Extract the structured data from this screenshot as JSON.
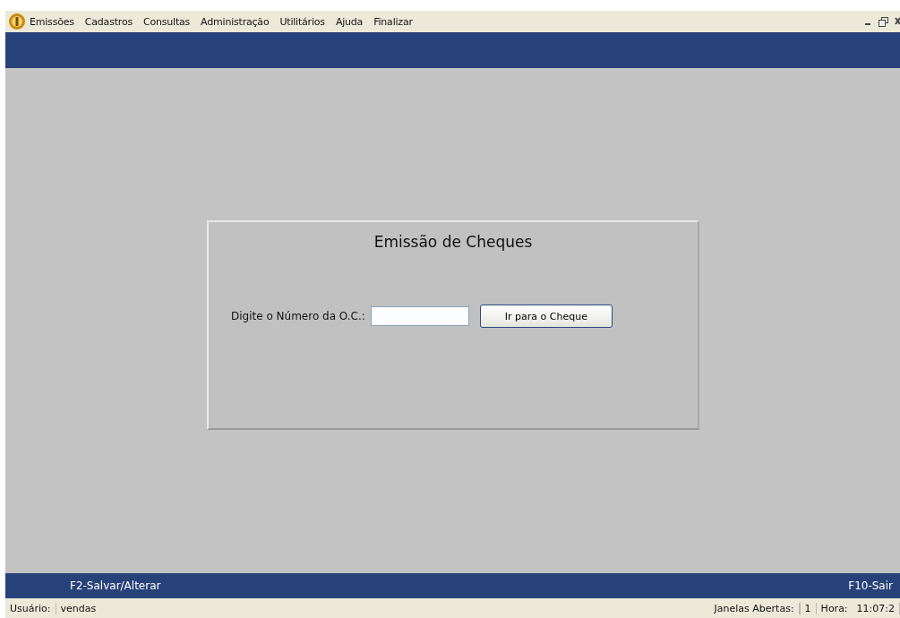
{
  "menu_bar": {
    "items": [
      {
        "label": "Emissões"
      },
      {
        "label": "Cadastros"
      },
      {
        "label": "Consultas"
      },
      {
        "label": "Administração"
      },
      {
        "label": "Utilitários"
      },
      {
        "label": "Ajuda"
      },
      {
        "label": "Finalizar"
      }
    ]
  },
  "dialog": {
    "title": "Emissão de Cheques",
    "field_label": "Digite o Número da O.C.:",
    "button": "Ir para o Cheque"
  },
  "function_bar": {
    "left": "F2-Salvar/Alterar",
    "right": "F10-Sair"
  },
  "status_bar": {
    "user_label": "Usuário:",
    "user": "vendas",
    "windows_label": "Janelas Abertas:",
    "windows": "1",
    "time_label": "Hora:",
    "time": "11:07:2"
  }
}
